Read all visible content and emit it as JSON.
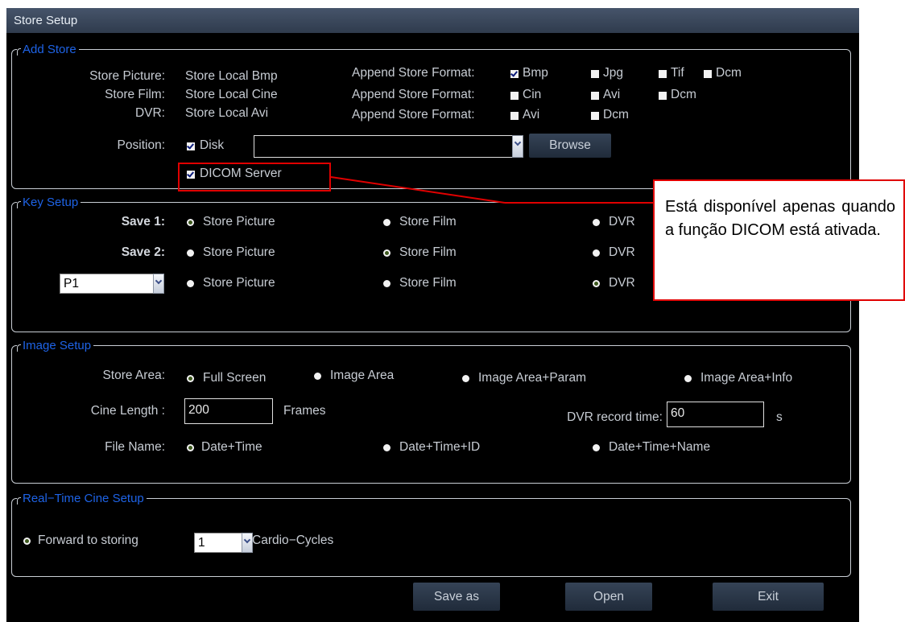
{
  "window": {
    "title": "Store Setup"
  },
  "add_store": {
    "legend": "Add Store",
    "store_picture_label": "Store Picture:",
    "store_picture_value": "Store Local Bmp",
    "store_film_label": "Store Film:",
    "store_film_value": "Store Local Cine",
    "dvr_label": "DVR:",
    "dvr_value": "Store Local Avi",
    "append_label": "Append Store Format:",
    "picture_formats": [
      "Bmp",
      "Jpg",
      "Tif",
      "Dcm"
    ],
    "film_formats": [
      "Cin",
      "Avi",
      "Dcm"
    ],
    "dvr_formats": [
      "Avi",
      "Dcm"
    ],
    "position_label": "Position:",
    "disk_label": "Disk",
    "disk_path": "",
    "browse_label": "Browse",
    "dicom_server_label": "DICOM Server"
  },
  "key_setup": {
    "legend": "Key Setup",
    "save1_label": "Save 1:",
    "save2_label": "Save 2:",
    "p_select": "P1",
    "opt_picture": "Store Picture",
    "opt_film": "Store Film",
    "opt_dvr": "DVR"
  },
  "image_setup": {
    "legend": "Image Setup",
    "store_area_label": "Store Area:",
    "area_full": "Full Screen",
    "area_image": "Image Area",
    "area_param": "Image Area+Param",
    "area_info": "Image Area+Info",
    "cine_length_label": "Cine Length :",
    "cine_length_value": "200",
    "frames_label": "Frames",
    "dvr_time_label": "DVR record time:",
    "dvr_time_value": "60",
    "seconds_unit": "s",
    "file_name_label": "File Name:",
    "fn_datetime": "Date+Time",
    "fn_datetime_id": "Date+Time+ID",
    "fn_datetime_name": "Date+Time+Name"
  },
  "realtime": {
    "legend": "Real−Time Cine Setup",
    "forward_label": "Forward to storing",
    "cycles_value": "1",
    "cycles_unit": "Cardio−Cycles"
  },
  "buttons": {
    "save_as": "Save as",
    "open": "Open",
    "exit": "Exit"
  },
  "callout": {
    "text": "Está disponível apenas quando a função DICOM está ativada."
  },
  "colors": {
    "legend": "#1e63e6",
    "highlight": "#e00000",
    "background": "#000000"
  }
}
